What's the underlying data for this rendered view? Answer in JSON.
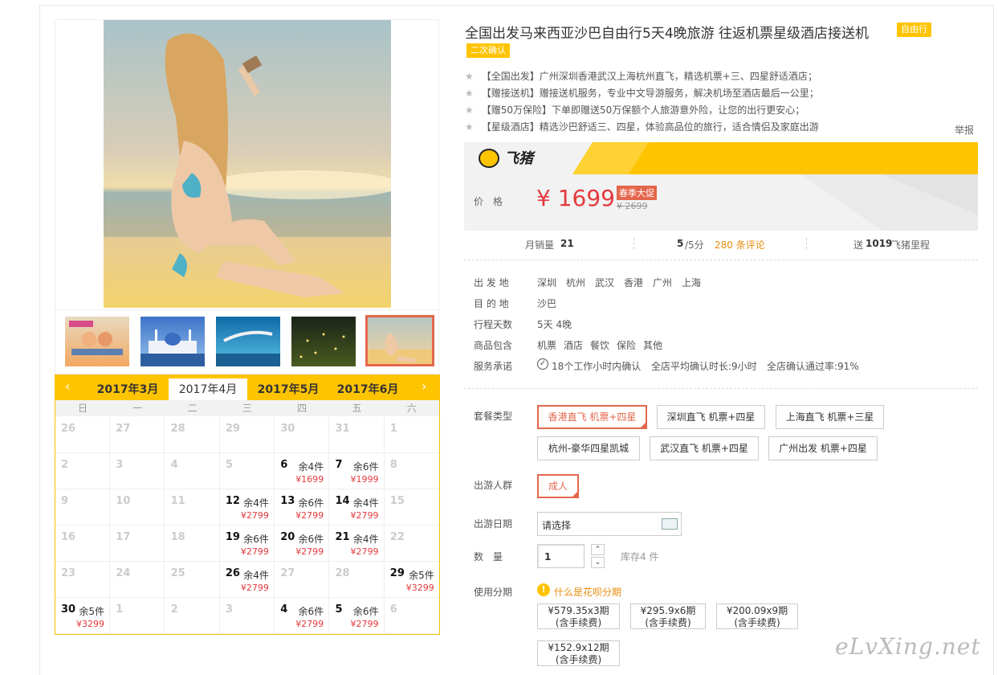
{
  "product": {
    "title": "全国出发马来西亚沙巴自由行5天4晚旅游 往返机票星级酒店接送机",
    "tag_free": "自由行",
    "tag_confirm": "二次确认",
    "features": [
      "【全国出发】广州深圳香港武汉上海杭州直飞，精选机票+三、四星舒适酒店；",
      "【赠接送机】赠接送机服务，专业中文导游服务，解决机场至酒店最后一公里；",
      "【赠50万保险】下单即赠送50万保额个人旅游意外险，让您的出行更安心；",
      "【星级酒店】精选沙巴舒适三、四星，体验高品位的旅行，适合情侣及家庭出游"
    ],
    "report": "举报"
  },
  "brand": {
    "name": "飞猪"
  },
  "price": {
    "label": "价　格",
    "current": "¥ 1699",
    "promo": "春季大促",
    "original": "¥ 2699"
  },
  "stats": {
    "sales_label": "月销量",
    "sales_value": "21",
    "rating_value": "5",
    "rating_unit": "/5分",
    "reviews": "280 条评论",
    "mileage_prefix": "送",
    "mileage_value": "1019",
    "mileage_suffix": "飞猪里程"
  },
  "info": {
    "departure_label": "出 发 地",
    "departures": [
      "深圳",
      "杭州",
      "武汉",
      "香港",
      "广州",
      "上海"
    ],
    "destination_label": "目 的 地",
    "destination": "沙巴",
    "days_label": "行程天数",
    "days": "5天 4晚",
    "includes_label": "商品包含",
    "includes": [
      "机票",
      "酒店",
      "餐饮",
      "保险",
      "其他"
    ],
    "service_label": "服务承诺",
    "service": [
      "18个工作小时内确认",
      "全店平均确认时长:9小时",
      "全店确认通过率:91%"
    ]
  },
  "options": {
    "package_label": "套餐类型",
    "packages": [
      "香港直飞 机票+四星",
      "深圳直飞 机票+四星",
      "上海直飞 机票+三星",
      "杭州-豪华四星凯城",
      "武汉直飞 机票+四星",
      "广州出发 机票+四星"
    ],
    "traveler_label": "出游人群",
    "traveler": "成人",
    "date_label": "出游日期",
    "date_placeholder": "请选择",
    "qty_label": "数　量",
    "qty_value": "1",
    "stock": "库存4 件",
    "installment_label": "使用分期",
    "installment_link": "什么是花呗分期",
    "installments": [
      {
        "line1": "¥579.35x3期",
        "line2": "(含手续费)"
      },
      {
        "line1": "¥295.9x6期",
        "line2": "(含手续费)"
      },
      {
        "line1": "¥200.09x9期",
        "line2": "(含手续费)"
      },
      {
        "line1": "¥152.9x12期",
        "line2": "(含手续费)"
      }
    ]
  },
  "calendar": {
    "months": [
      "2017年3月",
      "2017年4月",
      "2017年5月",
      "2017年6月"
    ],
    "active_month": "2017年4月",
    "weekdays": [
      "日",
      "一",
      "二",
      "三",
      "四",
      "五",
      "六"
    ],
    "cells": [
      {
        "d": "26"
      },
      {
        "d": "27"
      },
      {
        "d": "28"
      },
      {
        "d": "29"
      },
      {
        "d": "30"
      },
      {
        "d": "31"
      },
      {
        "d": "1"
      },
      {
        "d": "2"
      },
      {
        "d": "3"
      },
      {
        "d": "4"
      },
      {
        "d": "5"
      },
      {
        "d": "6",
        "r": "余4件",
        "p": "¥1699"
      },
      {
        "d": "7",
        "r": "余6件",
        "p": "¥1999"
      },
      {
        "d": "8"
      },
      {
        "d": "9"
      },
      {
        "d": "10"
      },
      {
        "d": "11"
      },
      {
        "d": "12",
        "r": "余4件",
        "p": "¥2799"
      },
      {
        "d": "13",
        "r": "余6件",
        "p": "¥2799"
      },
      {
        "d": "14",
        "r": "余4件",
        "p": "¥2799"
      },
      {
        "d": "15"
      },
      {
        "d": "16"
      },
      {
        "d": "17"
      },
      {
        "d": "18"
      },
      {
        "d": "19",
        "r": "余6件",
        "p": "¥2799"
      },
      {
        "d": "20",
        "r": "余6件",
        "p": "¥2799"
      },
      {
        "d": "21",
        "r": "余4件",
        "p": "¥2799"
      },
      {
        "d": "22"
      },
      {
        "d": "23"
      },
      {
        "d": "24"
      },
      {
        "d": "25"
      },
      {
        "d": "26",
        "r": "余4件",
        "p": "¥2799"
      },
      {
        "d": "27"
      },
      {
        "d": "28"
      },
      {
        "d": "29",
        "r": "余5件",
        "p": "¥3299"
      },
      {
        "d": "30",
        "r": "余5件",
        "p": "¥3299"
      },
      {
        "d": "1"
      },
      {
        "d": "2"
      },
      {
        "d": "3"
      },
      {
        "d": "4",
        "r": "余6件",
        "p": "¥2799"
      },
      {
        "d": "5",
        "r": "余6件",
        "p": "¥2799"
      },
      {
        "d": "6"
      }
    ]
  },
  "watermark": "eLvXing.net"
}
